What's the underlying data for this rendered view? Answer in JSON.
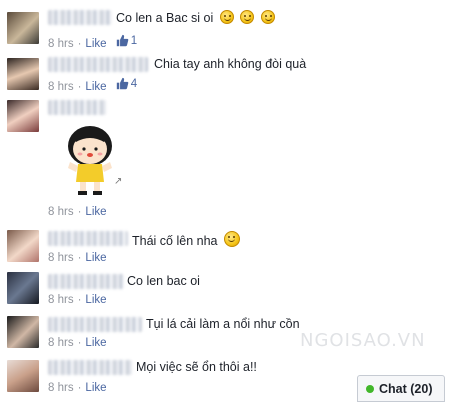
{
  "comments": [
    {
      "text": "Co len a Bac si oi",
      "time": "8 hrs",
      "like_label": "Like",
      "likes": "1",
      "emoji_count": 3
    },
    {
      "text": "Chia tay anh không đòi quà",
      "time": "8 hrs",
      "like_label": "Like",
      "likes": "4"
    },
    {
      "text": "",
      "time": "8 hrs",
      "like_label": "Like",
      "likes": "",
      "sticker": "yellow-shirt-girl-sticker"
    },
    {
      "text": "Thái cố lên nha",
      "time": "8 hrs",
      "like_label": "Like",
      "likes": "",
      "emoji_count": 1
    },
    {
      "text": "Co len bac oi",
      "time": "8 hrs",
      "like_label": "Like",
      "likes": ""
    },
    {
      "text": "Tụi lá cải làm a nổi như cồn",
      "time": "8 hrs",
      "like_label": "Like",
      "likes": ""
    },
    {
      "text": "Mọi việc sẽ ổn thôi a!!",
      "time": "8 hrs",
      "like_label": "Like",
      "likes": ""
    }
  ],
  "watermark": "NGOISAO.VN",
  "chat": {
    "label": "Chat (20)"
  },
  "colors": {
    "link": "#4b67a1",
    "meta": "#90949c",
    "online": "#42b72a"
  },
  "icons": [
    "thumbs-up-icon",
    "smiley-emoji-icon",
    "online-dot-icon"
  ]
}
